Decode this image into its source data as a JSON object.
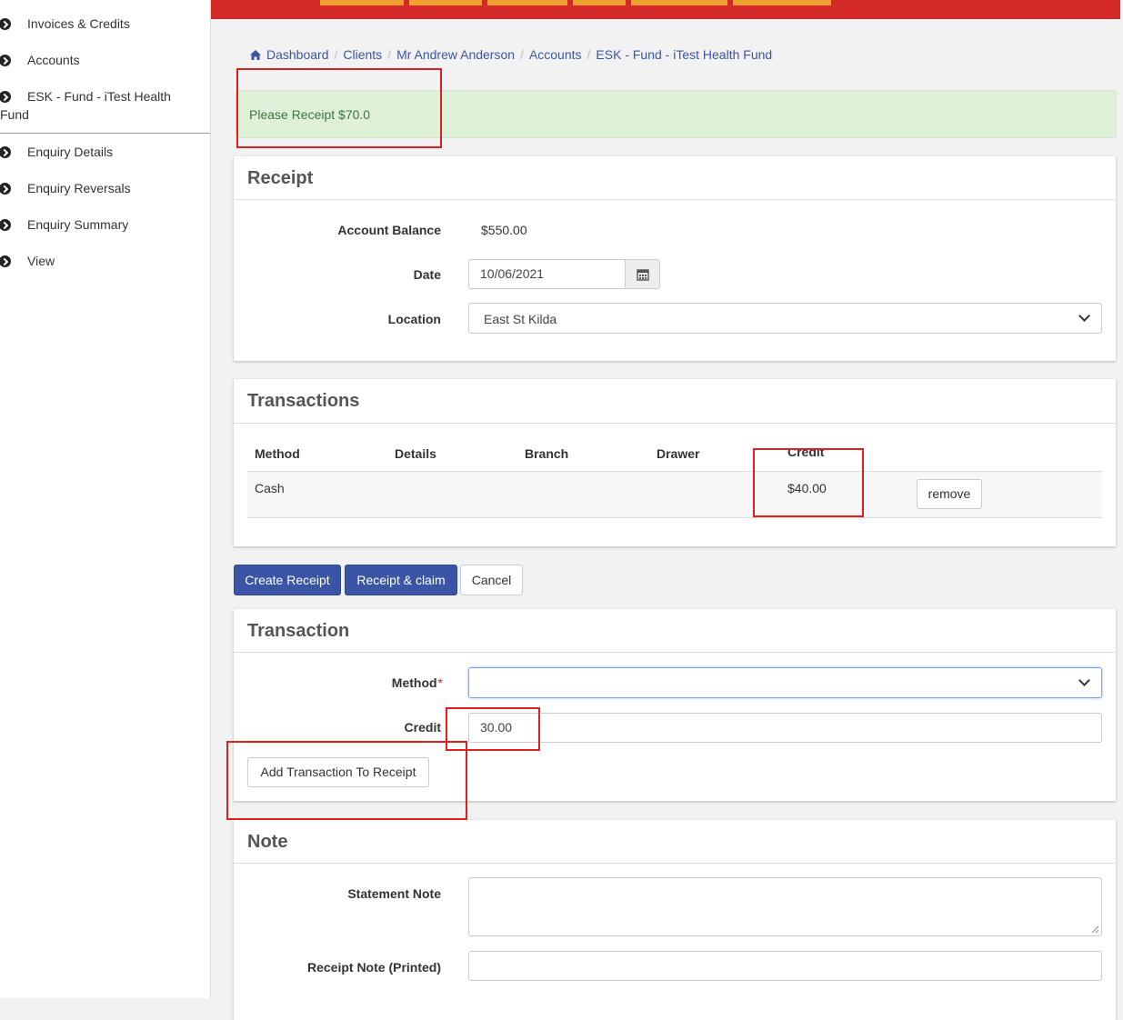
{
  "sidebar": {
    "items": [
      {
        "label": "Invoices & Credits"
      },
      {
        "label": "Accounts"
      },
      {
        "label": "ESK - Fund - iTest Health Fund"
      },
      {
        "label": "Enquiry Details"
      },
      {
        "label": "Enquiry Reversals"
      },
      {
        "label": "Enquiry Summary"
      },
      {
        "label": "View"
      }
    ]
  },
  "breadcrumb": [
    "Dashboard",
    "Clients",
    "Mr Andrew Anderson",
    "Accounts",
    "ESK - Fund - iTest Health Fund"
  ],
  "alert": {
    "text": "Please Receipt $70.0"
  },
  "receipt": {
    "title": "Receipt",
    "balance_label": "Account Balance",
    "balance_value": "$550.00",
    "date_label": "Date",
    "date_value": "10/06/2021",
    "location_label": "Location",
    "location_value": "East St Kilda"
  },
  "transactions": {
    "title": "Transactions",
    "columns": [
      "Method",
      "Details",
      "Branch",
      "Drawer",
      "Credit"
    ],
    "rows": [
      {
        "method": "Cash",
        "details": "",
        "branch": "",
        "drawer": "",
        "credit": "$40.00",
        "action": "remove"
      }
    ]
  },
  "actions": {
    "create": "Create Receipt",
    "receipt_claim": "Receipt & claim",
    "cancel": "Cancel"
  },
  "transaction_form": {
    "title": "Transaction",
    "method_label": "Method",
    "required_mark": "*",
    "method_value": "",
    "credit_label": "Credit",
    "credit_value": "30.00",
    "add_button": "Add Transaction To Receipt"
  },
  "note": {
    "title": "Note",
    "statement_label": "Statement Note",
    "receipt_label": "Receipt Note (Printed)"
  },
  "colors": {
    "primary": "#3a55a5",
    "topbar": "#d42a2a",
    "alert_bg": "#dff0d8",
    "annotation": "#e02020"
  }
}
